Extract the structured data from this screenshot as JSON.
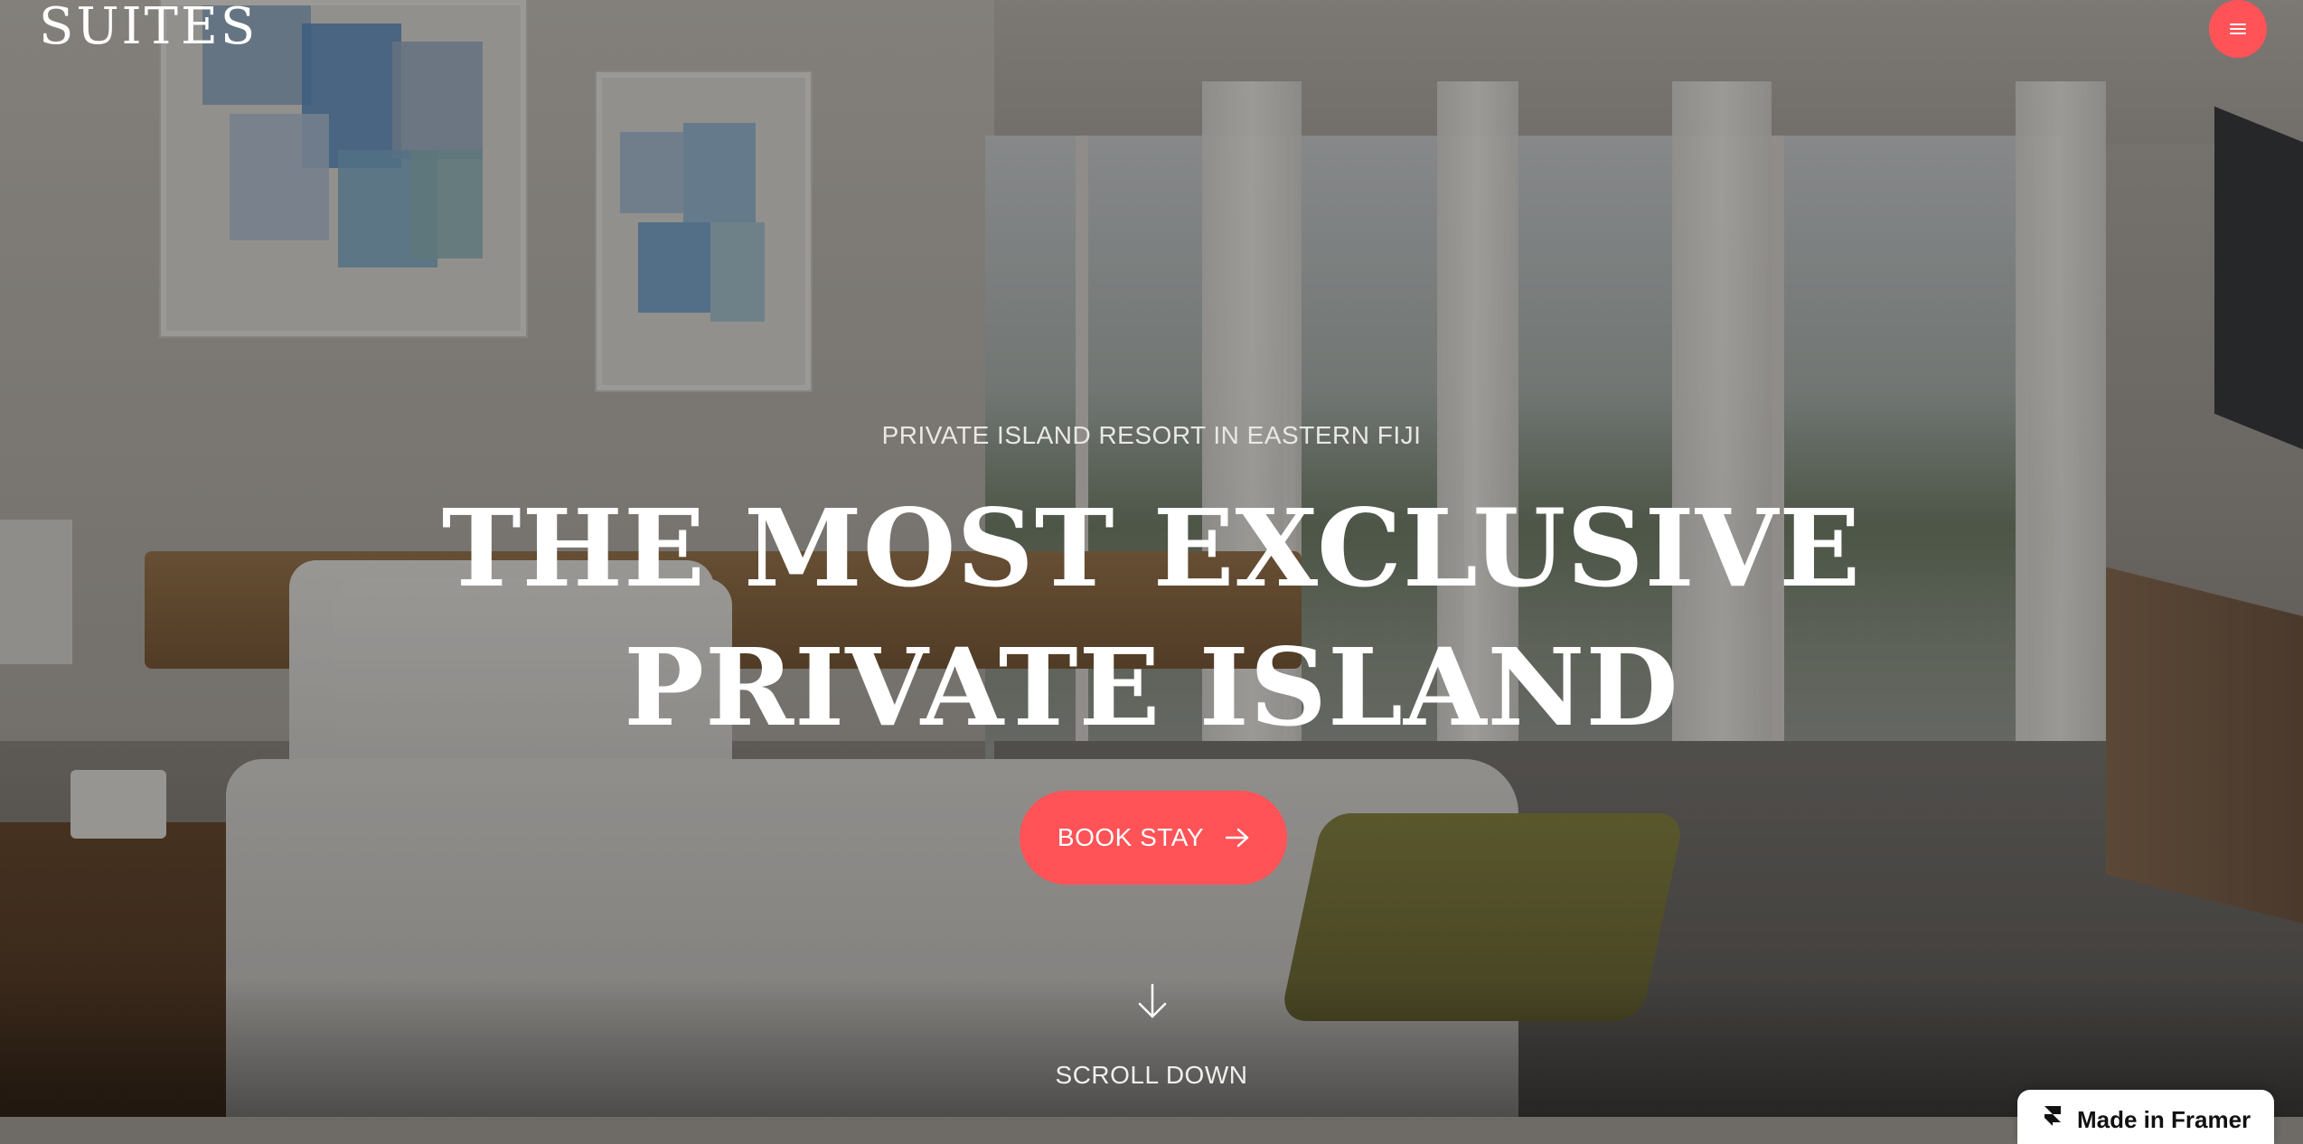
{
  "header": {
    "logo": "SUITES",
    "menu_icon": "hamburger-menu-icon"
  },
  "hero": {
    "eyebrow": "PRIVATE ISLAND RESORT IN EASTERN FIJI",
    "headline_lines": [
      "THE MOST EXCLUSIVE",
      "PRIVATE ISLAND"
    ],
    "cta_label": "BOOK STAY",
    "cta_icon": "arrow-right-icon",
    "scroll_label": "SCROLL DOWN",
    "scroll_icon": "arrow-down-icon"
  },
  "widget": {
    "label": "Made in Framer",
    "icon": "framer-logo-icon"
  },
  "colors": {
    "accent": "#ff5357",
    "text": "#ffffff",
    "overlay": "rgba(20,18,16,0.30)"
  }
}
